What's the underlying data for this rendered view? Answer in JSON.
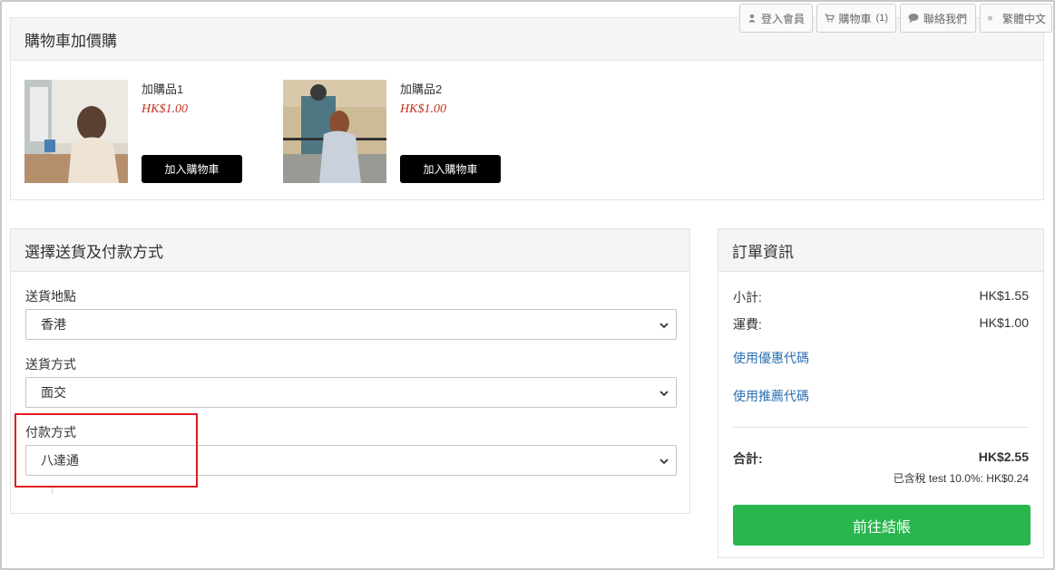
{
  "topnav": {
    "login": "登入會員",
    "cart": "購物車",
    "cart_count": "(1)",
    "contact": "聯絡我們",
    "language": "繁體中文"
  },
  "addon": {
    "title": "購物車加價購",
    "items": [
      {
        "name": "加購品1",
        "price": "HK$1.00",
        "button": "加入購物車"
      },
      {
        "name": "加購品2",
        "price": "HK$1.00",
        "button": "加入購物車"
      }
    ]
  },
  "shipping": {
    "title": "選擇送貨及付款方式",
    "location_label": "送貨地點",
    "location_value": "香港",
    "method_label": "送貨方式",
    "method_value": "面交",
    "payment_label": "付款方式",
    "payment_value": "八達通"
  },
  "order": {
    "title": "訂單資訊",
    "subtotal_label": "小計:",
    "subtotal_value": "HK$1.55",
    "shipping_label": "運費:",
    "shipping_value": "HK$1.00",
    "coupon_link": "使用優惠代碼",
    "referral_link": "使用推薦代碼",
    "total_label": "合計:",
    "total_value": "HK$2.55",
    "tax_note": "已含稅 test 10.0%: HK$0.24",
    "checkout_button": "前往結帳"
  },
  "colors": {
    "price": "#c0321e",
    "checkout": "#28b64d",
    "link": "#2a6fb0",
    "highlight": "#e0191e"
  }
}
